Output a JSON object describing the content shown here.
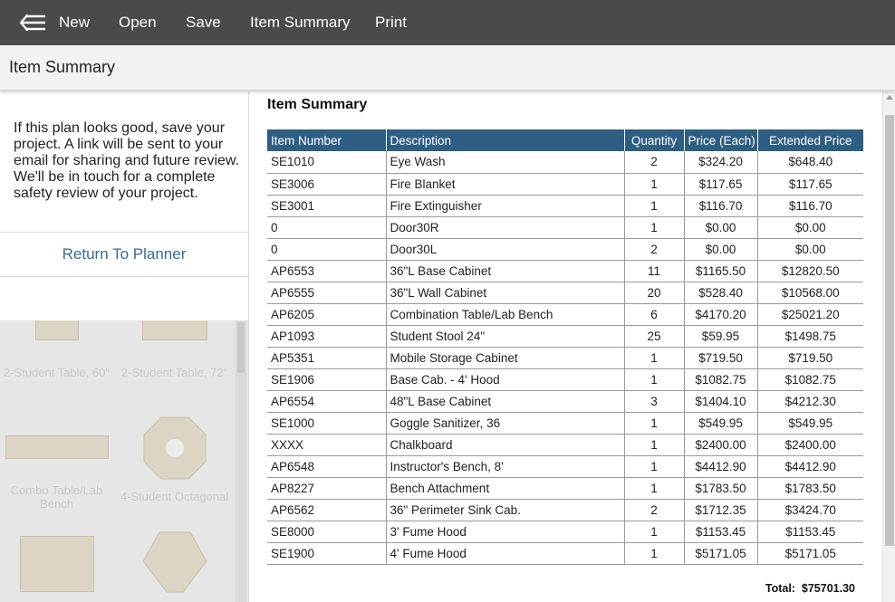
{
  "toolbar": {
    "menu_icon": "menu-back-icon",
    "new_label": "New",
    "open_label": "Open",
    "save_label": "Save",
    "summary_label": "Item Summary",
    "print_label": "Print",
    "background": "#4a4a4a"
  },
  "titlebar": {
    "title": "Item Summary"
  },
  "left": {
    "notice": "If this plan looks good, save your project. A link will be sent to your email for sharing and future review. We'll be in touch for a complete safety review of your project.",
    "return_label": "Return To Planner",
    "palette": [
      {
        "label": "2-Student Table, 60\""
      },
      {
        "label": "2-Student Table, 72\""
      },
      {
        "label": "Combo Table/Lab Bench"
      },
      {
        "label": "4-Student Octagonal"
      }
    ]
  },
  "main": {
    "title": "Item Summary",
    "columns": [
      "Item Number",
      "Description",
      "Quantity",
      "Price (Each)",
      "Extended Price"
    ],
    "rows": [
      [
        "SE1010",
        "Eye Wash",
        "2",
        "$324.20",
        "$648.40"
      ],
      [
        "SE3006",
        "Fire Blanket",
        "1",
        "$117.65",
        "$117.65"
      ],
      [
        "SE3001",
        "Fire Extinguisher",
        "1",
        "$116.70",
        "$116.70"
      ],
      [
        "0",
        "Door30R",
        "1",
        "$0.00",
        "$0.00"
      ],
      [
        "0",
        "Door30L",
        "2",
        "$0.00",
        "$0.00"
      ],
      [
        "AP6553",
        "36\"L Base Cabinet",
        "11",
        "$1165.50",
        "$12820.50"
      ],
      [
        "AP6555",
        "36\"L Wall Cabinet",
        "20",
        "$528.40",
        "$10568.00"
      ],
      [
        "AP6205",
        "Combination Table/Lab Bench",
        "6",
        "$4170.20",
        "$25021.20"
      ],
      [
        "AP1093",
        "Student Stool 24\"",
        "25",
        "$59.95",
        "$1498.75"
      ],
      [
        "AP5351",
        "Mobile Storage Cabinet",
        "1",
        "$719.50",
        "$719.50"
      ],
      [
        "SE1906",
        "Base Cab. - 4' Hood",
        "1",
        "$1082.75",
        "$1082.75"
      ],
      [
        "AP6554",
        "48\"L Base Cabinet",
        "3",
        "$1404.10",
        "$4212.30"
      ],
      [
        "SE1000",
        "Goggle Sanitizer, 36",
        "1",
        "$549.95",
        "$549.95"
      ],
      [
        "XXXX",
        "Chalkboard",
        "1",
        "$2400.00",
        "$2400.00"
      ],
      [
        "AP6548",
        "Instructor's Bench, 8'",
        "1",
        "$4412.90",
        "$4412.90"
      ],
      [
        "AP8227",
        "Bench Attachment",
        "1",
        "$1783.50",
        "$1783.50"
      ],
      [
        "AP6562",
        "36\" Perimeter Sink Cab.",
        "2",
        "$1712.35",
        "$3424.70"
      ],
      [
        "SE8000",
        "3' Fume Hood",
        "1",
        "$1153.45",
        "$1153.45"
      ],
      [
        "SE1900",
        "4' Fume Hood",
        "1",
        "$5171.05",
        "$5171.05"
      ]
    ],
    "total_label": "Total:",
    "total_value": "$75701.30",
    "header_color": "#2f5e84"
  }
}
